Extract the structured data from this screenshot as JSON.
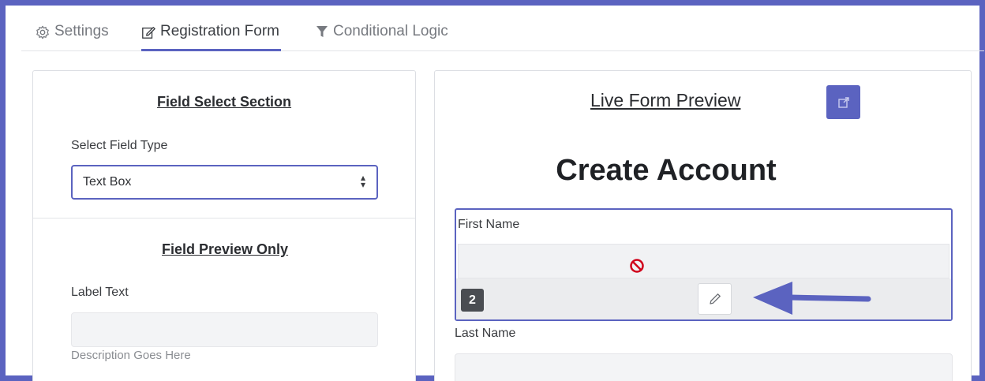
{
  "tabs": [
    {
      "label": "Settings",
      "icon": "gear-icon",
      "active": false
    },
    {
      "label": "Registration Form",
      "icon": "edit-form-icon",
      "active": true
    },
    {
      "label": "Conditional Logic",
      "icon": "filter-icon",
      "active": false
    }
  ],
  "left_panel": {
    "field_select_title": "Field Select Section",
    "select_label": "Select Field Type",
    "select_value": "Text Box",
    "field_preview_title": "Field Preview Only",
    "label_text": "Label Text",
    "description": "Description Goes Here"
  },
  "right_panel": {
    "preview_title": "Live Form Preview",
    "popout_icon": "external-link-icon",
    "form_heading": "Create Account",
    "fields": [
      {
        "label": "First Name",
        "order_badge": "2",
        "state": "disabled",
        "icon": "no-entry-icon"
      },
      {
        "label": "Last Name"
      }
    ],
    "edit_icon": "pencil-icon"
  },
  "colors": {
    "accent": "#5b63c0",
    "no_entry": "#d0021b",
    "badge": "#4a4d52"
  }
}
